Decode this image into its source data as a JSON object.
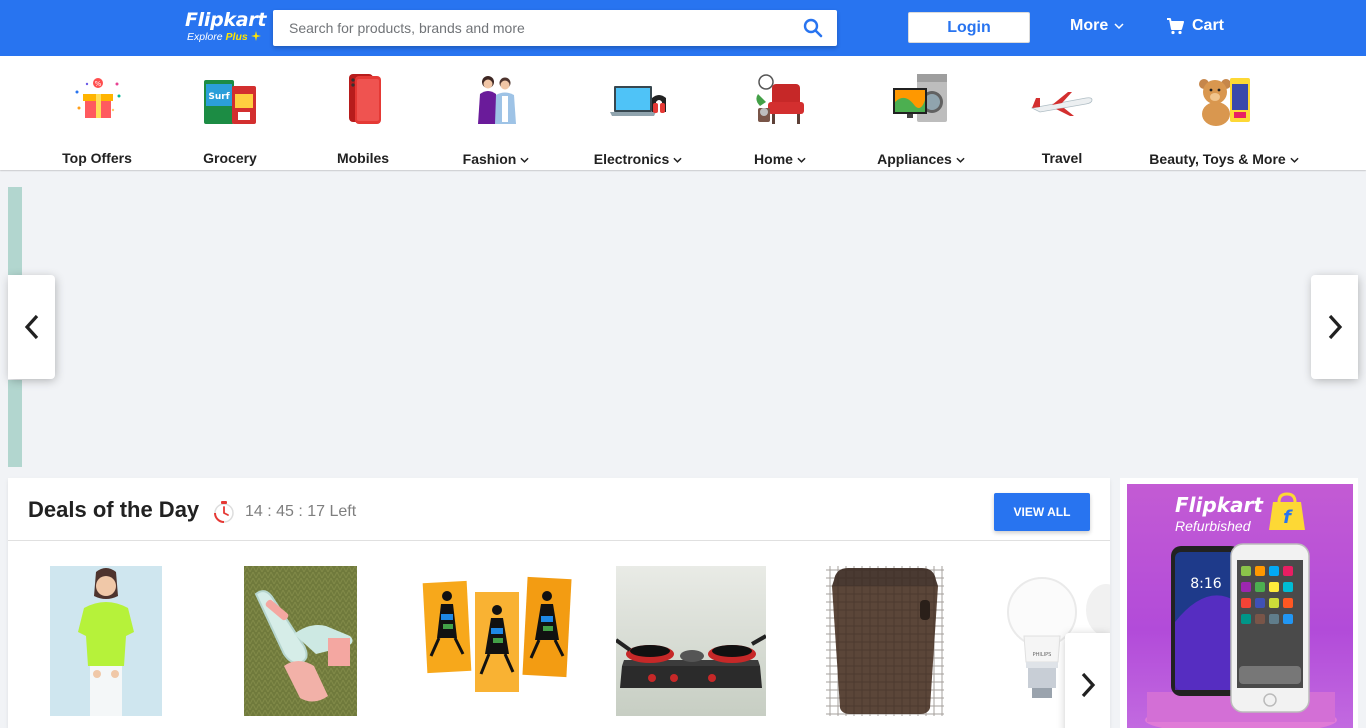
{
  "header": {
    "logo_text": "Flipkart",
    "logo_sub": "Explore",
    "logo_plus": "Plus",
    "search_placeholder": "Search for products, brands and more",
    "login_label": "Login",
    "more_label": "More",
    "cart_label": "Cart",
    "brand_color": "#2874f0",
    "accent_color": "#ffe500"
  },
  "categories": [
    {
      "label": "Top Offers",
      "icon": "gift-icon",
      "has_dropdown": false
    },
    {
      "label": "Grocery",
      "icon": "grocery-icon",
      "has_dropdown": false
    },
    {
      "label": "Mobiles",
      "icon": "mobile-phone-icon",
      "has_dropdown": false
    },
    {
      "label": "Fashion",
      "icon": "fashion-icon",
      "has_dropdown": true
    },
    {
      "label": "Electronics",
      "icon": "laptop-icon",
      "has_dropdown": true
    },
    {
      "label": "Home",
      "icon": "armchair-icon",
      "has_dropdown": true
    },
    {
      "label": "Appliances",
      "icon": "tv-washer-icon",
      "has_dropdown": true
    },
    {
      "label": "Travel",
      "icon": "airplane-icon",
      "has_dropdown": false
    },
    {
      "label": "Beauty, Toys & More",
      "icon": "teddy-bear-icon",
      "has_dropdown": true
    }
  ],
  "deals": {
    "title": "Deals of the Day",
    "timer": "14 : 45 : 17 Left",
    "view_all_label": "VIEW ALL",
    "products": [
      {
        "name": "green-top"
      },
      {
        "name": "block-heel-sandals"
      },
      {
        "name": "tribal-wall-art"
      },
      {
        "name": "gas-stove"
      },
      {
        "name": "laundry-basket"
      },
      {
        "name": "led-bulb"
      }
    ]
  },
  "ad": {
    "brand": "Flipkart",
    "sub": "Refurbished",
    "phone_time": "8:16"
  }
}
